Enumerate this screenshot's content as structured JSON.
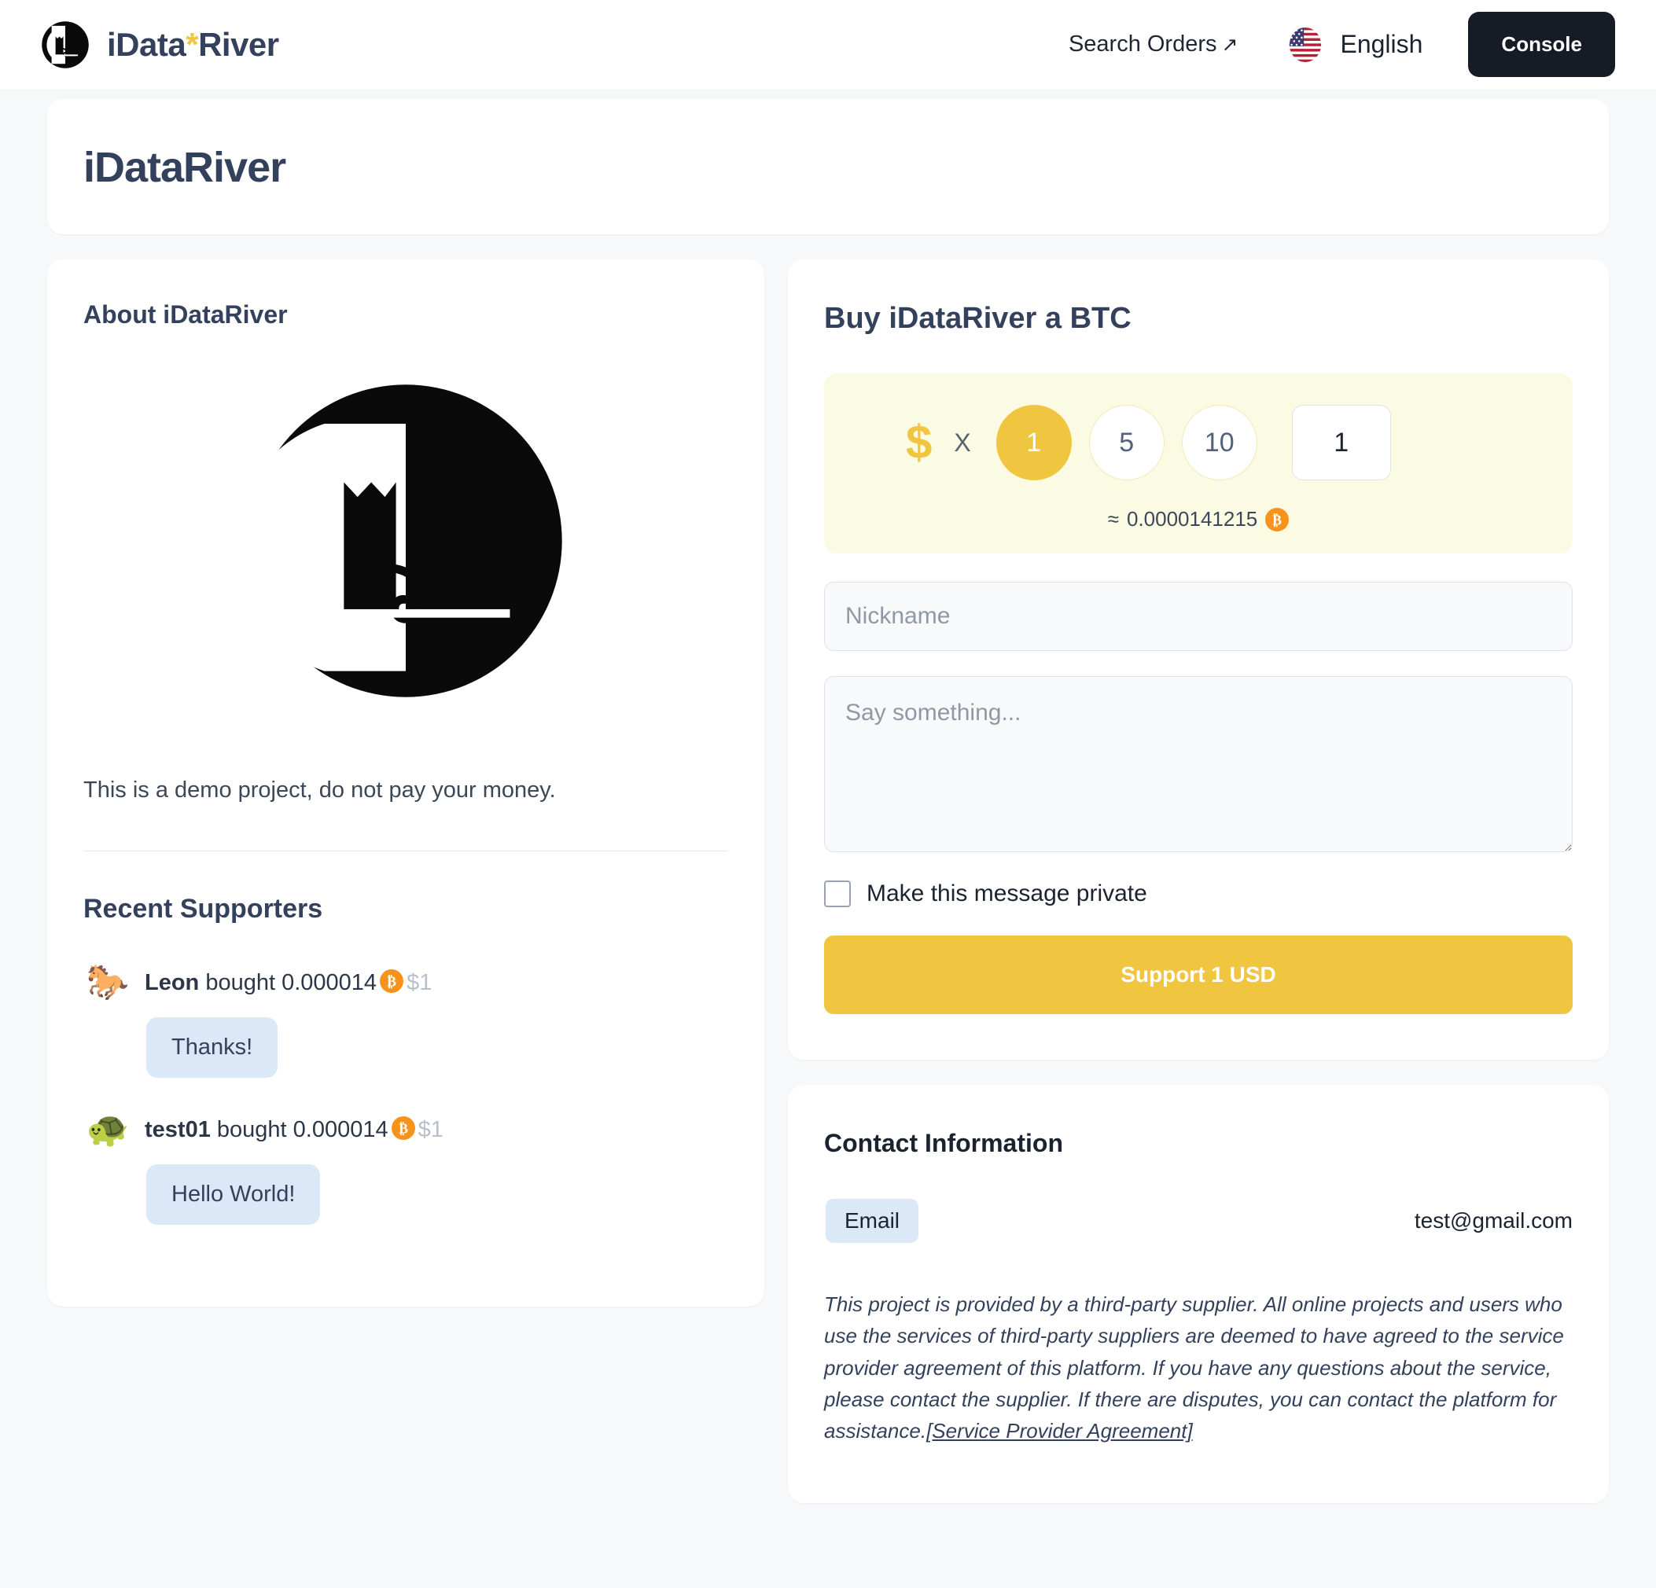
{
  "header": {
    "brand_prefix": "iData",
    "brand_star": "*",
    "brand_suffix": "River",
    "search_orders_label": "Search Orders",
    "search_orders_arrow": "↗",
    "language_label": "English",
    "console_label": "Console"
  },
  "hero": {
    "title": "iDataRiver"
  },
  "about": {
    "section_title": "About iDataRiver",
    "description": "This is a demo project, do not pay your money.",
    "supporters_title": "Recent Supporters",
    "supporters": [
      {
        "avatar": "🐎",
        "name": "Leon",
        "action": "bought",
        "amount": "0.000014",
        "usd": "$1",
        "message": "Thanks!"
      },
      {
        "avatar": "🐢",
        "name": "test01",
        "action": "bought",
        "amount": "0.000014",
        "usd": "$1",
        "message": "Hello World!"
      }
    ]
  },
  "buy": {
    "title": "Buy iDataRiver a BTC",
    "currency_symbol": "$",
    "multiplier": "X",
    "presets": [
      "1",
      "5",
      "10"
    ],
    "selected_preset": "1",
    "custom_amount": "1",
    "approx_prefix": "≈",
    "approx_value": "0.0000141215",
    "nickname_placeholder": "Nickname",
    "message_placeholder": "Say something...",
    "private_label": "Make this message private",
    "private_checked": false,
    "submit_label": "Support 1 USD"
  },
  "contact": {
    "title": "Contact Information",
    "rows": [
      {
        "badge": "Email",
        "value": "test@gmail.com"
      }
    ],
    "disclaimer": "This project is provided by a third-party supplier. All online projects and users who use the services of third-party suppliers are deemed to have agreed to the service provider agreement of this platform. If you have any questions about the service, please contact the supplier. If there are disputes, you can contact the platform for assistance.",
    "disclaimer_link": "[Service Provider Agreement]"
  },
  "colors": {
    "accent_yellow": "#f0c640",
    "amount_panel_bg": "#fbfbe4",
    "bitcoin_orange": "#f7931a",
    "bubble_blue": "#dbe8f8",
    "console_dark": "#161b26",
    "page_bg": "#f6f8fa",
    "text_dark": "#33415c"
  }
}
